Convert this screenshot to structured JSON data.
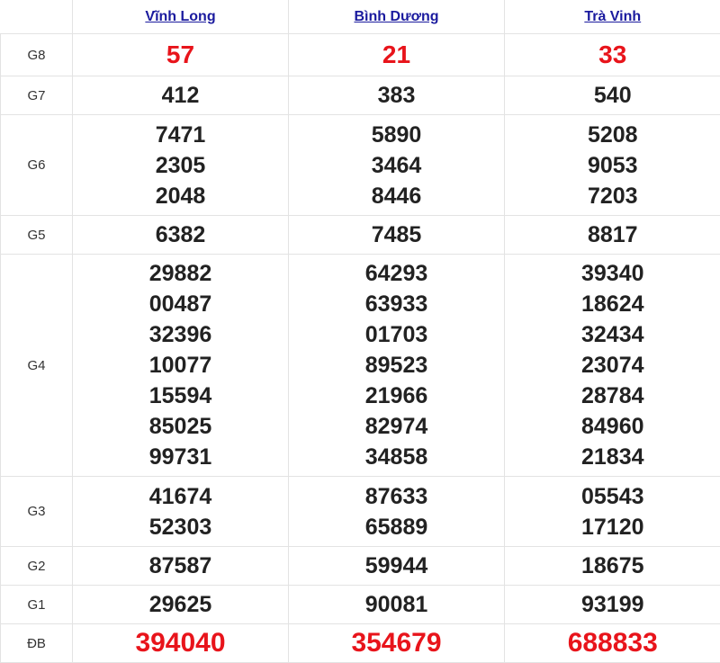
{
  "provinces": [
    "Vĩnh Long",
    "Bình Dương",
    "Trà Vinh"
  ],
  "rows": [
    {
      "key": "g8",
      "label": "G8",
      "style": "red big",
      "values": [
        [
          "57"
        ],
        [
          "21"
        ],
        [
          "33"
        ]
      ]
    },
    {
      "key": "g7",
      "label": "G7",
      "style": "",
      "values": [
        [
          "412"
        ],
        [
          "383"
        ],
        [
          "540"
        ]
      ]
    },
    {
      "key": "g6",
      "label": "G6",
      "style": "",
      "values": [
        [
          "7471",
          "2305",
          "2048"
        ],
        [
          "5890",
          "3464",
          "8446"
        ],
        [
          "5208",
          "9053",
          "7203"
        ]
      ]
    },
    {
      "key": "g5",
      "label": "G5",
      "style": "",
      "values": [
        [
          "6382"
        ],
        [
          "7485"
        ],
        [
          "8817"
        ]
      ]
    },
    {
      "key": "g4",
      "label": "G4",
      "style": "",
      "values": [
        [
          "29882",
          "00487",
          "32396",
          "10077",
          "15594",
          "85025",
          "99731"
        ],
        [
          "64293",
          "63933",
          "01703",
          "89523",
          "21966",
          "82974",
          "34858"
        ],
        [
          "39340",
          "18624",
          "32434",
          "23074",
          "28784",
          "84960",
          "21834"
        ]
      ]
    },
    {
      "key": "g3",
      "label": "G3",
      "style": "",
      "values": [
        [
          "41674",
          "52303"
        ],
        [
          "87633",
          "65889"
        ],
        [
          "05543",
          "17120"
        ]
      ]
    },
    {
      "key": "g2",
      "label": "G2",
      "style": "",
      "values": [
        [
          "87587"
        ],
        [
          "59944"
        ],
        [
          "18675"
        ]
      ]
    },
    {
      "key": "g1",
      "label": "G1",
      "style": "",
      "values": [
        [
          "29625"
        ],
        [
          "90081"
        ],
        [
          "93199"
        ]
      ]
    },
    {
      "key": "db",
      "label": "ĐB",
      "style": "red huge",
      "values": [
        [
          "394040"
        ],
        [
          "354679"
        ],
        [
          "688833"
        ]
      ]
    }
  ],
  "colors": {
    "accent_red": "#e8141b",
    "link_blue": "#1a1a9e",
    "text": "#222222"
  }
}
